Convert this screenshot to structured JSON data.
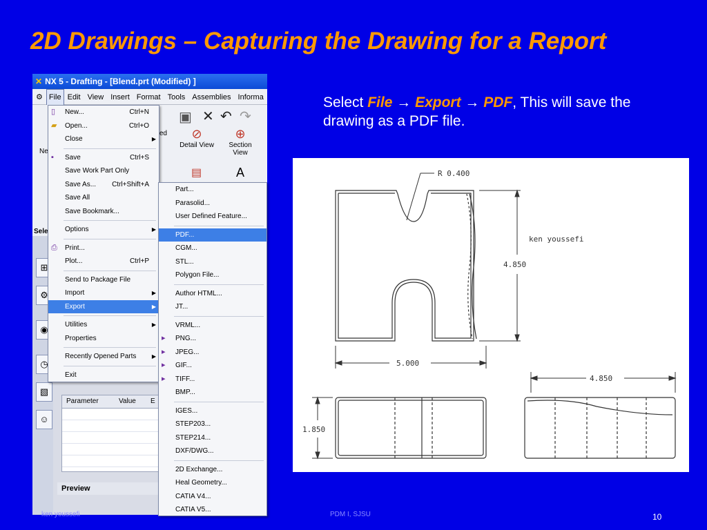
{
  "slide": {
    "title": "2D Drawings – Capturing the Drawing for a Report",
    "desc_prefix": "Select ",
    "desc_file": "File",
    "desc_arrow1": " → ",
    "desc_export": "Export",
    "desc_arrow2": " → ",
    "desc_pdf": "PDF",
    "desc_suffix": ", This will save the drawing as a PDF file.",
    "footer_left": "ken youssefi",
    "footer_center": "PDM I, SJSU",
    "page_number": "10"
  },
  "window": {
    "title": "NX 5 - Drafting - [Blend.prt (Modified) ]",
    "menubar": [
      "File",
      "Edit",
      "View",
      "Insert",
      "Format",
      "Tools",
      "Assemblies",
      "Informa"
    ],
    "tools": [
      {
        "label": "Detail View",
        "icon": "detail-view-icon"
      },
      {
        "label": "Section View",
        "icon": "section-view-icon"
      },
      {
        "label": "ted",
        "icon": "projected-view-icon"
      }
    ],
    "left_labels": {
      "ne": "Ne",
      "sel": "Sele"
    },
    "grid_headers": [
      "Parameter",
      "Value",
      "E"
    ],
    "preview_label": "Preview"
  },
  "file_menu": [
    {
      "label": "New...",
      "shortcut": "Ctrl+N",
      "icon": "new-file-icon"
    },
    {
      "label": "Open...",
      "shortcut": "Ctrl+O",
      "icon": "open-folder-icon"
    },
    {
      "label": "Close",
      "submenu": true
    },
    {
      "sep": true
    },
    {
      "label": "Save",
      "shortcut": "Ctrl+S",
      "icon": "save-icon"
    },
    {
      "label": "Save Work Part Only"
    },
    {
      "label": "Save As...",
      "shortcut": "Ctrl+Shift+A"
    },
    {
      "label": "Save All"
    },
    {
      "label": "Save Bookmark..."
    },
    {
      "sep": true
    },
    {
      "label": "Options",
      "submenu": true
    },
    {
      "sep": true
    },
    {
      "label": "Print...",
      "icon": "print-icon"
    },
    {
      "label": "Plot...",
      "shortcut": "Ctrl+P"
    },
    {
      "sep": true
    },
    {
      "label": "Send to Package File"
    },
    {
      "label": "Import",
      "submenu": true
    },
    {
      "label": "Export",
      "submenu": true,
      "highlight": true
    },
    {
      "sep": true
    },
    {
      "label": "Utilities",
      "submenu": true
    },
    {
      "label": "Properties"
    },
    {
      "sep": true
    },
    {
      "label": "Recently Opened Parts",
      "submenu": true
    },
    {
      "sep": true
    },
    {
      "label": "Exit"
    }
  ],
  "export_menu": [
    {
      "label": "Part..."
    },
    {
      "label": "Parasolid..."
    },
    {
      "label": "User Defined Feature..."
    },
    {
      "sep": true
    },
    {
      "label": "PDF...",
      "highlight": true
    },
    {
      "label": "CGM..."
    },
    {
      "label": "STL..."
    },
    {
      "label": "Polygon File..."
    },
    {
      "sep": true
    },
    {
      "label": "Author HTML..."
    },
    {
      "label": "JT..."
    },
    {
      "sep": true
    },
    {
      "label": "VRML..."
    },
    {
      "label": "PNG...",
      "icon": "png-icon"
    },
    {
      "label": "JPEG...",
      "icon": "jpeg-icon"
    },
    {
      "label": "GIF...",
      "icon": "gif-icon"
    },
    {
      "label": "TIFF...",
      "icon": "tiff-icon"
    },
    {
      "label": "BMP..."
    },
    {
      "sep": true
    },
    {
      "label": "IGES..."
    },
    {
      "label": "STEP203..."
    },
    {
      "label": "STEP214..."
    },
    {
      "label": "DXF/DWG..."
    },
    {
      "sep": true
    },
    {
      "label": "2D Exchange..."
    },
    {
      "label": "Heal Geometry..."
    },
    {
      "label": "CATIA V4..."
    },
    {
      "label": "CATIA V5..."
    }
  ],
  "drawing": {
    "radius_label": "R 0.400",
    "height_dim": "4.850",
    "width_dim": "5.000",
    "side_width_dim": "4.850",
    "thickness_dim": "1.850",
    "author": "ken youssefi"
  }
}
